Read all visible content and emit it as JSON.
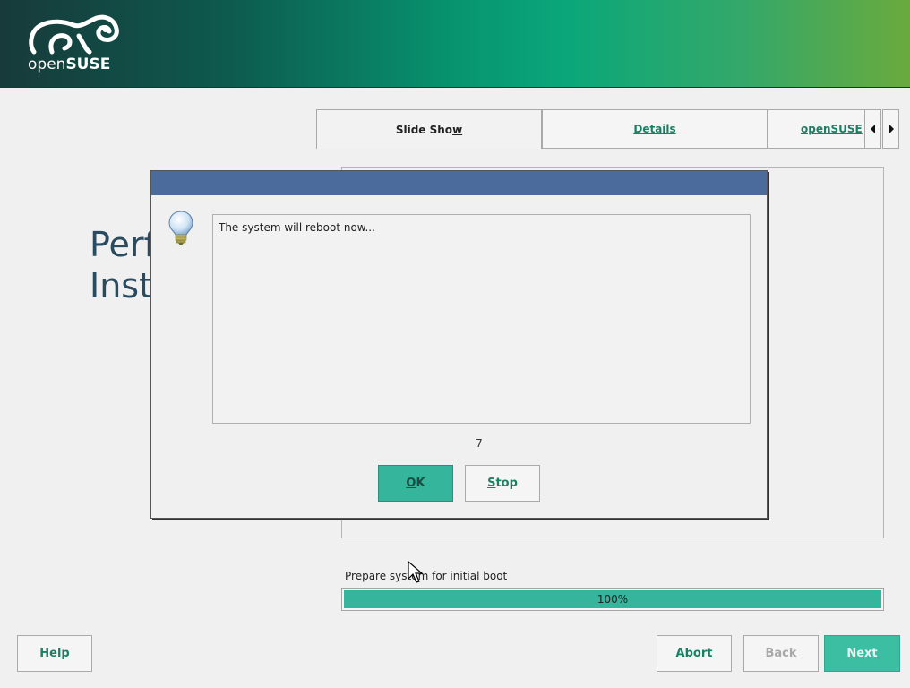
{
  "brand": {
    "logo_light": "open",
    "logo_bold": "SUSE"
  },
  "tabs": [
    {
      "label_pre": "Slide Sho",
      "label_ul": "w",
      "label_post": ""
    },
    {
      "label_pre": "",
      "label_ul": "D",
      "label_post": "etails"
    },
    {
      "label_pre": "openSUSE",
      "label_ul": "",
      "label_post": ""
    }
  ],
  "background_title": {
    "line1": "Perf",
    "line2": "Inst"
  },
  "dialog": {
    "message": "The system will reboot now...",
    "countdown": "7",
    "ok": {
      "ul": "O",
      "rest": "K"
    },
    "stop": {
      "ul": "S",
      "rest": "top"
    }
  },
  "progress": {
    "label": "Prepare system for initial boot",
    "value_text": "100%",
    "value": 1.0
  },
  "footer": {
    "help": "Help",
    "abort": {
      "pre": "Abo",
      "ul": "r",
      "post": "t"
    },
    "back": {
      "ul": "B",
      "rest": "ack"
    },
    "next": {
      "ul": "N",
      "rest": "ext"
    }
  },
  "colors": {
    "accent": "#35b59b",
    "link": "#1b7f62",
    "dialog_titlebar": "#4a6b9c"
  },
  "icons": [
    "opensuse-chameleon-logo",
    "lightbulb-icon",
    "arrow-left-icon",
    "arrow-right-icon",
    "mouse-cursor-icon"
  ]
}
